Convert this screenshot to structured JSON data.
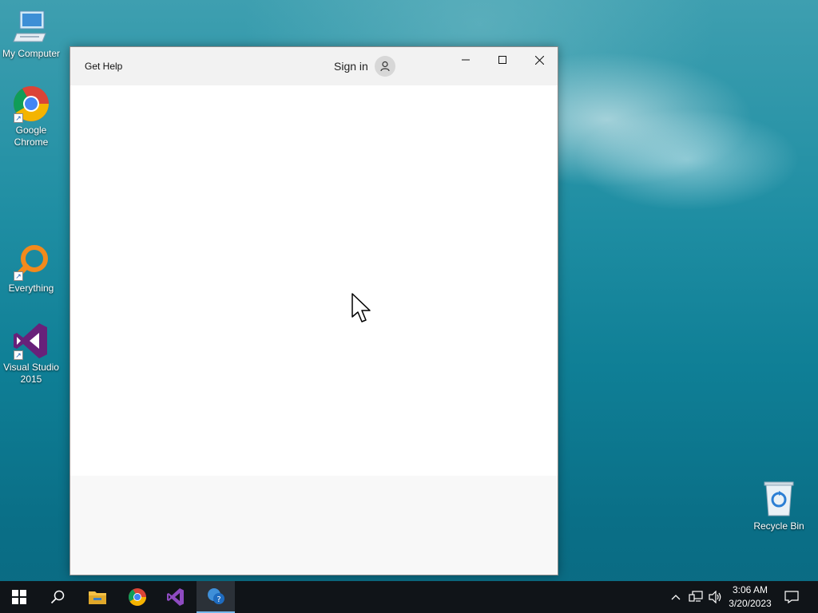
{
  "desktop": {
    "icons": [
      {
        "label": "My Computer"
      },
      {
        "label": "Google Chrome"
      },
      {
        "label": "Everything"
      },
      {
        "label": "Visual Studio 2015"
      },
      {
        "label": "Recycle Bin"
      }
    ]
  },
  "window": {
    "title": "Get Help",
    "sign_in_label": "Sign in"
  },
  "taskbar": {
    "pinned": [
      "start-icon",
      "search-icon",
      "file-explorer-icon",
      "chrome-icon",
      "visual-studio-icon",
      "get-help-icon"
    ],
    "clock": {
      "time": "3:06 AM",
      "date": "3/20/2023"
    }
  }
}
